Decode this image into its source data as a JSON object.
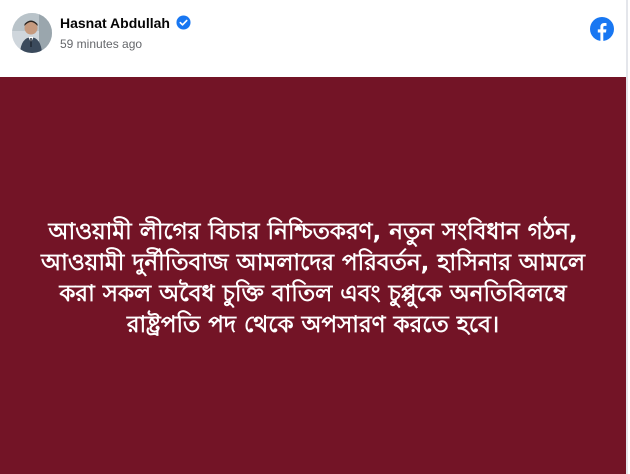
{
  "author": {
    "name": "Hasnat Abdullah",
    "timestamp": "59 minutes ago",
    "verified": true
  },
  "post": {
    "background_color": "#731426",
    "text_color": "#ffffff",
    "text": "আওয়ামী লীগের বিচার নিশ্চিতকরণ, নতুন সংবিধান গঠন, আওয়ামী দুর্নীতিবাজ আমলাদের পরিবর্তন, হাসিনার আমলে করা সকল অবৈধ চুক্তি বাতিল এবং চুপ্পুকে অনতিবিলম্বে রাষ্ট্রপতি পদ থেকে অপসারণ করতে হবে।"
  },
  "icons": {
    "verified": "verified-badge-icon",
    "platform": "facebook-logo-icon"
  },
  "colors": {
    "facebook_blue": "#1877f2",
    "name_text": "#050505",
    "secondary_text": "#65676b"
  }
}
